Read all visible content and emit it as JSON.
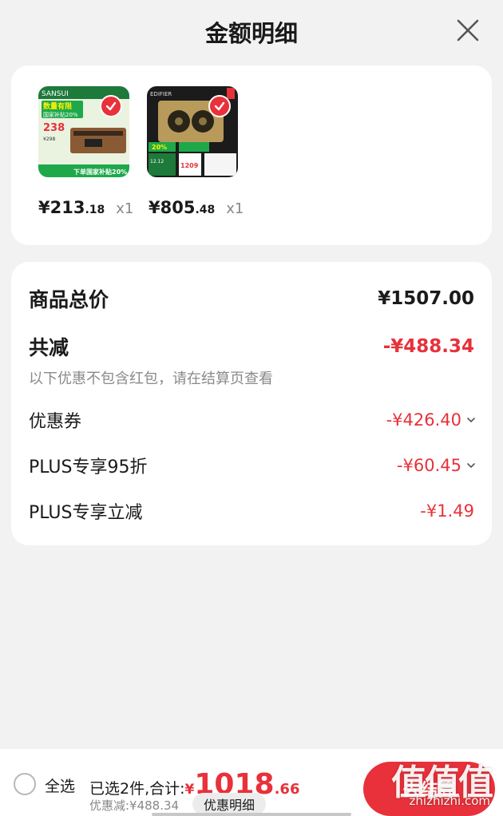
{
  "header": {
    "title": "金额明细"
  },
  "products": [
    {
      "price_int": "¥213",
      "price_dec": ".18",
      "qty": "x1",
      "promo_price": "238",
      "promo_sub": "¥298",
      "promo_tag": "数量有限",
      "promo_sub2": "国家补贴20%",
      "bottom_tag": "下单国家补贴20%",
      "brand": "SANSUI"
    },
    {
      "price_int": "¥805",
      "price_dec": ".48",
      "qty": "x1",
      "promo_price": "1209",
      "promo_tag": "20%",
      "promo_sub2": "12.12",
      "brand": "EDIFIER"
    }
  ],
  "summary": {
    "total_label": "商品总价",
    "total_value": "¥1507.00",
    "reduce_label": "共减",
    "reduce_value": "-¥488.34",
    "note": "以下优惠不包含红包，请在结算页查看",
    "items": [
      {
        "label": "优惠券",
        "value": "-¥426.40",
        "expandable": true
      },
      {
        "label": "PLUS专享95折",
        "value": "-¥60.45",
        "expandable": true
      },
      {
        "label": "PLUS专享立减",
        "value": "-¥1.49",
        "expandable": false
      }
    ]
  },
  "bottom": {
    "select_all": "全选",
    "selected_text": "已选2件,合计:",
    "total_currency": "¥",
    "total_int": "1018",
    "total_dec": ".66",
    "discount_text": "优惠减:¥488.34",
    "discount_button": "优惠明细",
    "checkout": "去结算"
  },
  "watermark": {
    "glyphs": "值值值",
    "url": "zhizhizhi.com"
  },
  "colors": {
    "accent": "#e8313a",
    "background": "#f2f2f2"
  }
}
